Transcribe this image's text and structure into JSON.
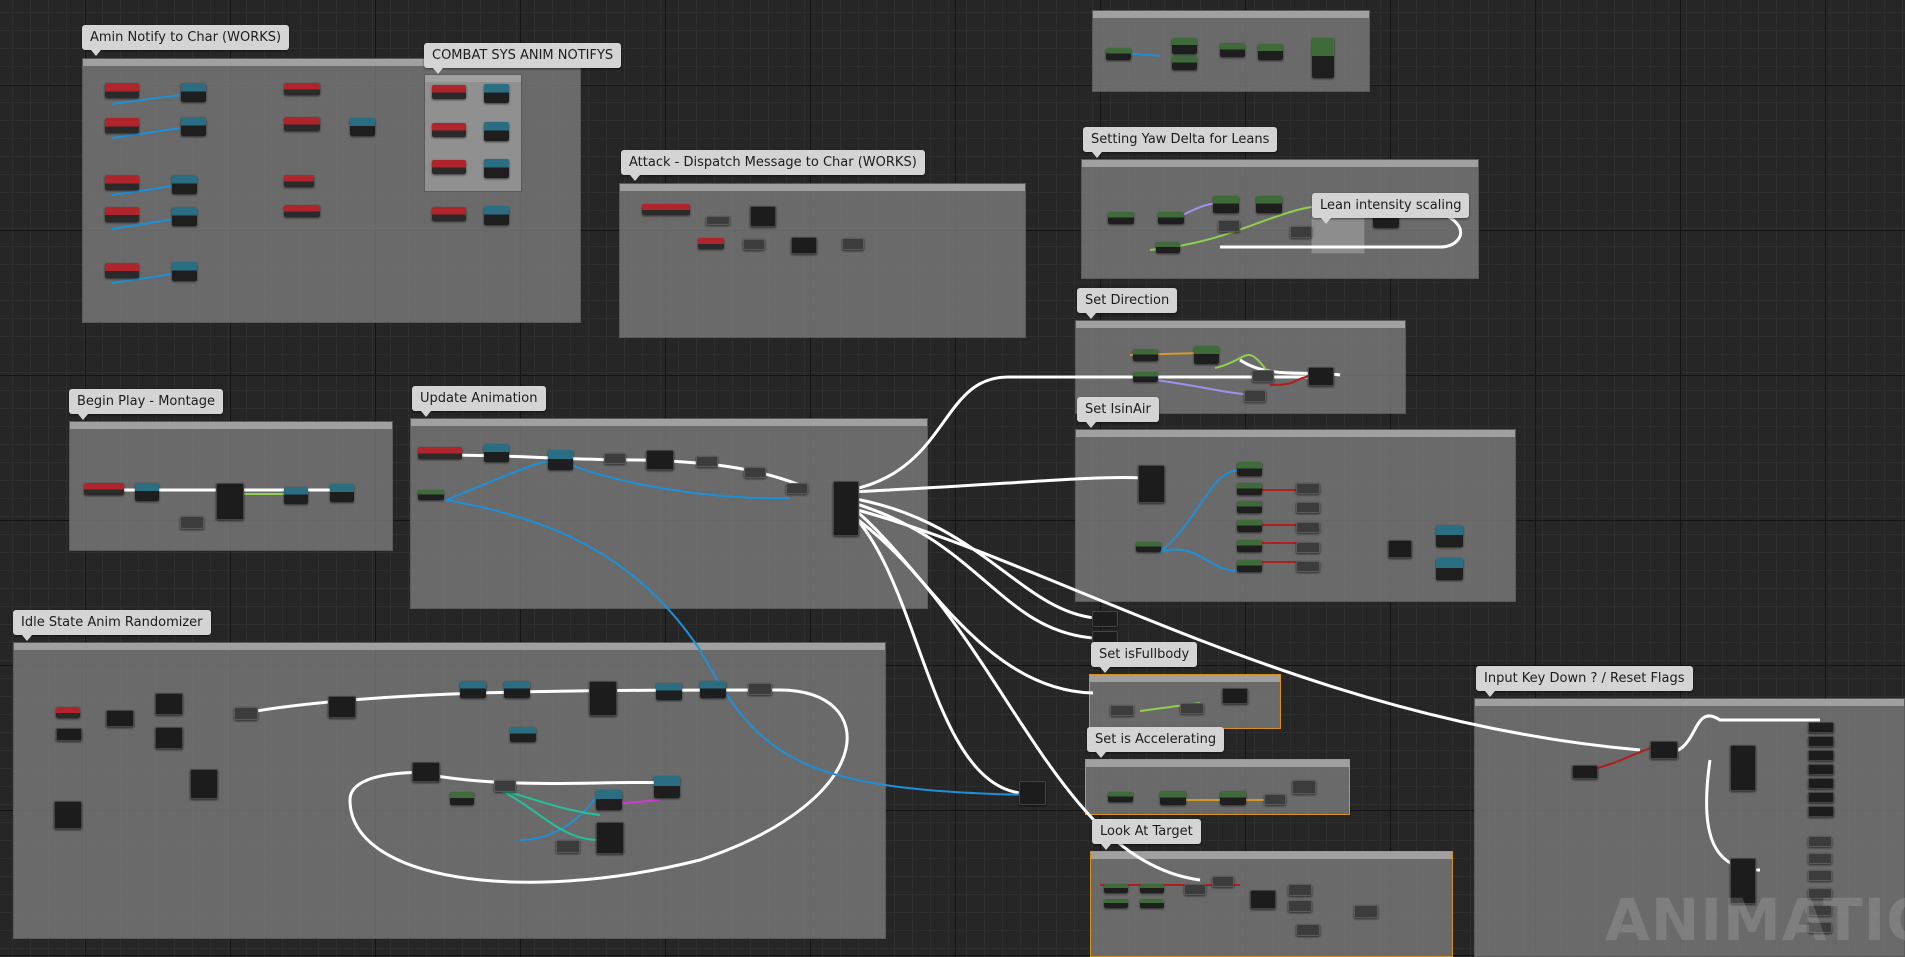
{
  "comments": {
    "notify": "Amin Notify to Char  (WORKS)",
    "combat": "COMBAT SYS ANIM NOTIFYS",
    "attack": "Attack - Dispatch Message to Char (WORKS)",
    "yaw": "Setting Yaw Delta for Leans",
    "lean": "Lean intensity scaling",
    "direction": "Set Direction",
    "isinair": "Set IsinAir",
    "beginplay": "Begin Play - Montage",
    "update": "Update Animation",
    "idle": "Idle State Anim Randomizer",
    "fullbody": "Set isFullbody",
    "accelerating": "Set is Accelerating",
    "lookat": "Look At Target",
    "inputkey": "Input Key Down ? / Reset Flags"
  },
  "watermark": "ANIMATION",
  "colors": {
    "background": "#262626",
    "comment_fill": "#7a7a7a",
    "event_node": "#b0242b",
    "function_node": "#2b6e82",
    "variable_node": "#3f6a3a",
    "exec_wire": "#ffffff",
    "object_wire": "#1e90d8",
    "float_wire": "#8fd14f",
    "bool_wire": "#b01e1e",
    "highlight_border": "#d6901c"
  }
}
